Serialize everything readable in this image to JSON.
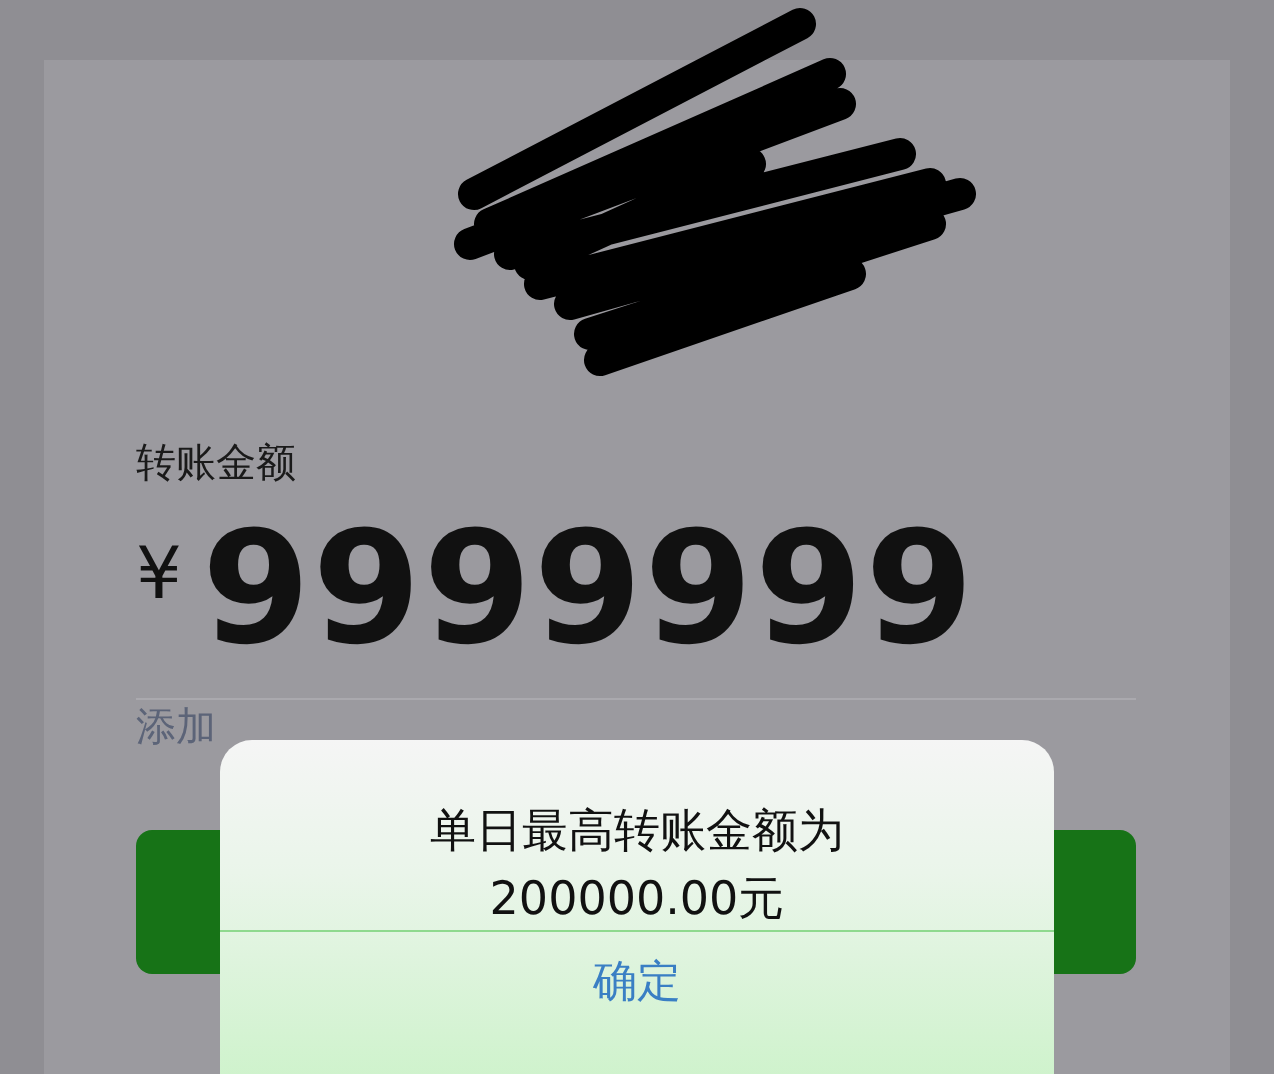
{
  "amount_label": "转账金额",
  "currency": "¥",
  "amount": "9999999",
  "note_link": "添加",
  "alert": {
    "message_lines": [
      "单日最高转账金额为",
      "200000.00元"
    ],
    "button": "确定"
  }
}
